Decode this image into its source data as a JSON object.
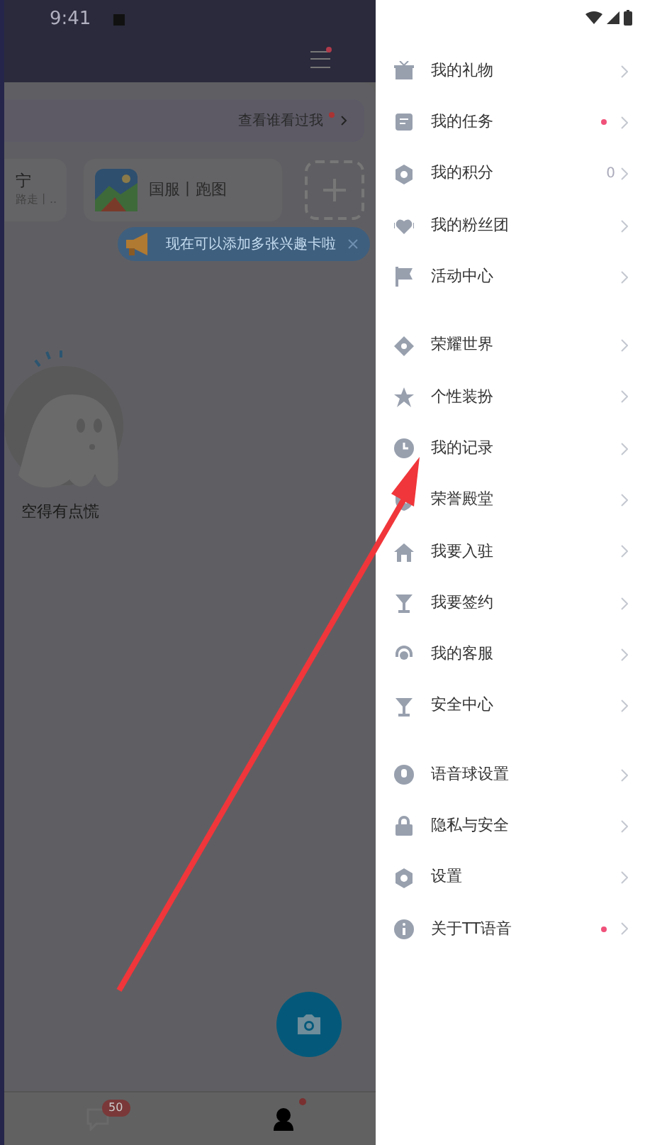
{
  "status_bar": {
    "time": "9:41"
  },
  "profile": {
    "visitors_link": "查看谁看过我",
    "visitors_new": true,
    "interest_cards": [
      {
        "title": "宁",
        "subtitle": "路走丨..",
        "kind": "partial"
      },
      {
        "title": "国服丨跑图",
        "kind": "game"
      }
    ],
    "tip": "现在可以添加多张兴趣卡啦",
    "empty_text": "空得有点慌"
  },
  "bottom_tabs": [
    {
      "kind": "chat",
      "badge": "50",
      "selected": false,
      "dot": false
    },
    {
      "kind": "me",
      "selected": true,
      "dot": true
    }
  ],
  "menu_groups": [
    [
      {
        "kind": "gift",
        "label": "我的礼物",
        "dot": false
      },
      {
        "kind": "task",
        "label": "我的任务",
        "dot": true
      },
      {
        "kind": "points",
        "label": "我的积分",
        "value": "0",
        "dot": false
      },
      {
        "kind": "heart",
        "label": "我的粉丝团",
        "dot": false
      },
      {
        "kind": "flag",
        "label": "活动中心",
        "dot": false
      }
    ],
    [
      {
        "kind": "diamond",
        "label": "荣耀世界",
        "dot": false
      },
      {
        "kind": "star",
        "label": "个性装扮",
        "dot": false
      },
      {
        "kind": "clock",
        "label": "我的记录",
        "dot": false
      },
      {
        "kind": "shield",
        "label": "荣誉殿堂",
        "dot": false
      },
      {
        "kind": "home",
        "label": "我要入驻",
        "dot": false
      },
      {
        "kind": "cup",
        "label": "我要签约",
        "dot": false
      },
      {
        "kind": "headset",
        "label": "我的客服",
        "dot": false
      },
      {
        "kind": "cup",
        "label": "安全中心",
        "dot": false
      }
    ],
    [
      {
        "kind": "mic",
        "label": "语音球设置",
        "dot": false
      },
      {
        "kind": "lock",
        "label": "隐私与安全",
        "dot": false
      },
      {
        "kind": "gear",
        "label": "设置",
        "dot": false
      },
      {
        "kind": "info",
        "label": "关于TT语音",
        "dot": true
      }
    ]
  ]
}
